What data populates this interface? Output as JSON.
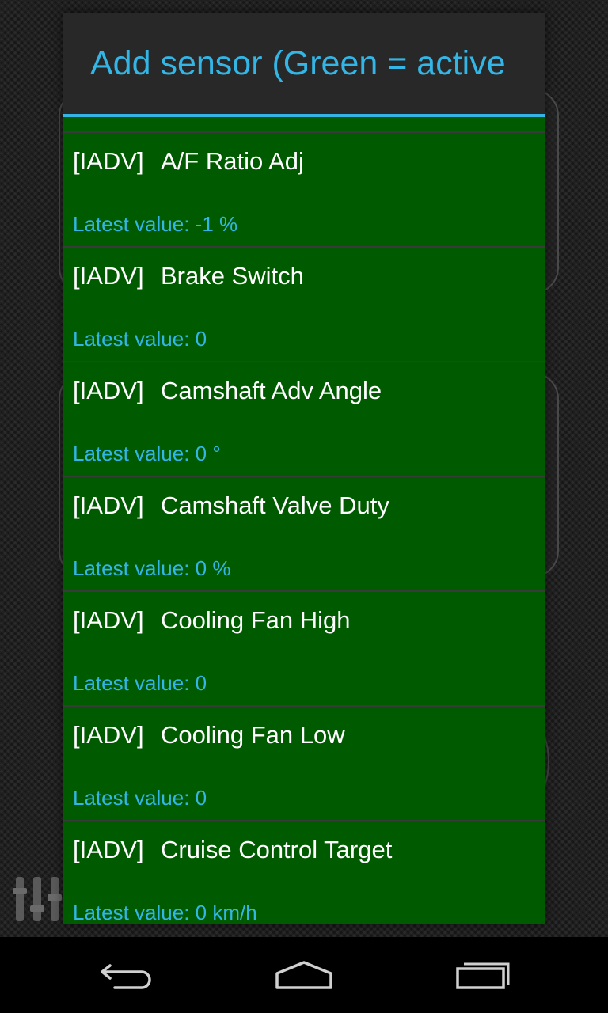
{
  "dialog": {
    "title": "Add sensor (Green  = active"
  },
  "sensors": [
    {
      "tag": "[IADV]",
      "name": "A/F Ratio Adj",
      "value": "Latest value: -1 %"
    },
    {
      "tag": "[IADV]",
      "name": "Brake Switch",
      "value": "Latest value: 0"
    },
    {
      "tag": "[IADV]",
      "name": "Camshaft Adv Angle",
      "value": "Latest value: 0 °"
    },
    {
      "tag": "[IADV]",
      "name": "Camshaft Valve Duty",
      "value": "Latest value: 0 %"
    },
    {
      "tag": "[IADV]",
      "name": "Cooling Fan High",
      "value": "Latest value: 0"
    },
    {
      "tag": "[IADV]",
      "name": "Cooling Fan Low",
      "value": "Latest value: 0"
    },
    {
      "tag": "[IADV]",
      "name": "Cruise Control Target",
      "value": "Latest value: 0 km/h"
    }
  ],
  "colors": {
    "accent": "#33b5e5",
    "active_item": "#005a00",
    "dialog_bg": "#282828"
  },
  "navbar": {
    "icons": [
      "back-icon",
      "home-icon",
      "recent-apps-icon"
    ]
  }
}
